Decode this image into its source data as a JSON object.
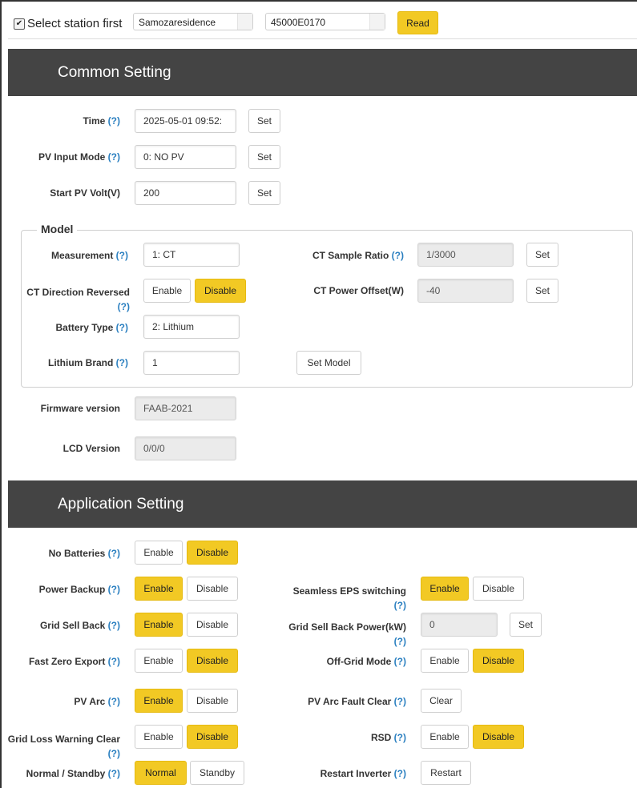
{
  "topbar": {
    "select_station_label": "Select station first",
    "station_value": "Samozaresidence",
    "serial_value": "45000E0170",
    "read_label": "Read"
  },
  "common": {
    "title": "Common Setting",
    "time_label": "Time",
    "time_value": "2025-05-01 09:52:",
    "pv_input_mode_label": "PV Input Mode",
    "pv_input_mode_value": "0: NO PV",
    "start_pv_volt_label": "Start PV Volt(V)",
    "start_pv_volt_value": "200",
    "set_label": "Set",
    "firmware_label": "Firmware version",
    "firmware_value": "FAAB-2021",
    "lcd_label": "LCD Version",
    "lcd_value": "0/0/0"
  },
  "model": {
    "legend": "Model",
    "measurement_label": "Measurement",
    "measurement_value": "1: CT",
    "ct_sample_ratio_label": "CT Sample Ratio",
    "ct_sample_ratio_value": "1/3000",
    "ct_direction_label": "CT Direction Reversed",
    "ct_power_offset_label": "CT Power Offset(W)",
    "ct_power_offset_value": "-40",
    "battery_type_label": "Battery Type",
    "battery_type_value": "2: Lithium",
    "lithium_brand_label": "Lithium Brand",
    "lithium_brand_value": "1",
    "set_model_label": "Set Model"
  },
  "application": {
    "title": "Application Setting",
    "no_batteries_label": "No Batteries",
    "power_backup_label": "Power Backup",
    "seamless_eps_label": "Seamless EPS switching",
    "grid_sell_back_label": "Grid Sell Back",
    "grid_sell_back_power_label": "Grid Sell Back Power(kW)",
    "grid_sell_back_power_value": "0",
    "fast_zero_export_label": "Fast Zero Export",
    "off_grid_mode_label": "Off-Grid Mode",
    "pv_arc_label": "PV Arc",
    "pv_arc_fault_clear_label": "PV Arc Fault Clear",
    "clear_label": "Clear",
    "grid_loss_warning_label": "Grid Loss Warning Clear",
    "rsd_label": "RSD",
    "normal_standby_label": "Normal / Standby",
    "normal_label": "Normal",
    "standby_label": "Standby",
    "restart_inverter_label": "Restart Inverter",
    "restart_label": "Restart"
  },
  "common_labels": {
    "enable": "Enable",
    "disable": "Disable",
    "help": "(?)",
    "check": "✔"
  },
  "colors": {
    "accent": "#f2c924",
    "header_bg": "#444444",
    "help_link": "#2a7fc0"
  }
}
